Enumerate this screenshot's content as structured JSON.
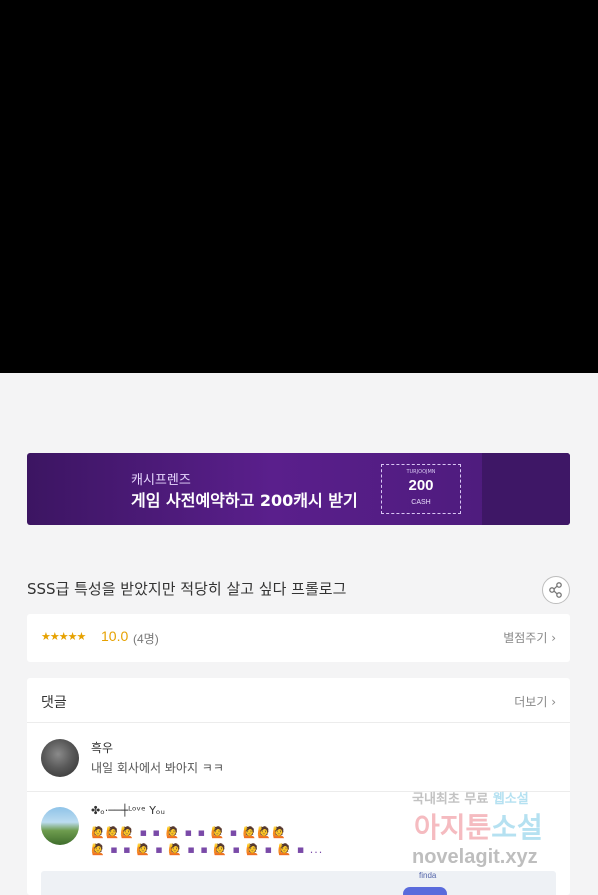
{
  "banner": {
    "brand": "캐시프렌즈",
    "title": "게임 사전예약하고 200캐시 받기",
    "ticket_small": "TURJOOJMN",
    "ticket_amount": "200",
    "ticket_unit": "CASH",
    "colors": {
      "bg": "#5a1f8c",
      "text": "#ffffff"
    }
  },
  "episode": {
    "title": "SSS급 특성을 받았지만 적당히 살고 싶다 프롤로그",
    "share_icon": "share-icon"
  },
  "rating": {
    "stars": "★★★★★",
    "score": "10.0",
    "count": "(4명)",
    "rate_button": "별점주기 ›",
    "color": "#e6a100"
  },
  "comments": {
    "label": "댓글",
    "more": "더보기 ›",
    "items": [
      {
        "name": "흑우",
        "text": "내일 회사에서 봐아지 ㅋㅋ"
      },
      {
        "name": "✤ₒ·──┼ᴸᵒᵛᵉ Yₒᵤ",
        "line1": "🙋🙋🙋 ▪ ▪ 🙋 ▪ ▪ 🙋 ▪ 🙋🙋🙋",
        "line2": "🙋 ▪ ▪ 🙋 ▪ 🙋 ▪ ▪ 🙋 ▪ 🙋 ▪ 🙋 ▪ ..."
      }
    ],
    "ad_tag": "finda"
  },
  "watermark": {
    "line1_a": "국내최초 무료 ",
    "line1_b": "웹소설",
    "line2_a": "아지툰",
    "line2_b": "소설",
    "line3": "novelagit.xyz"
  }
}
